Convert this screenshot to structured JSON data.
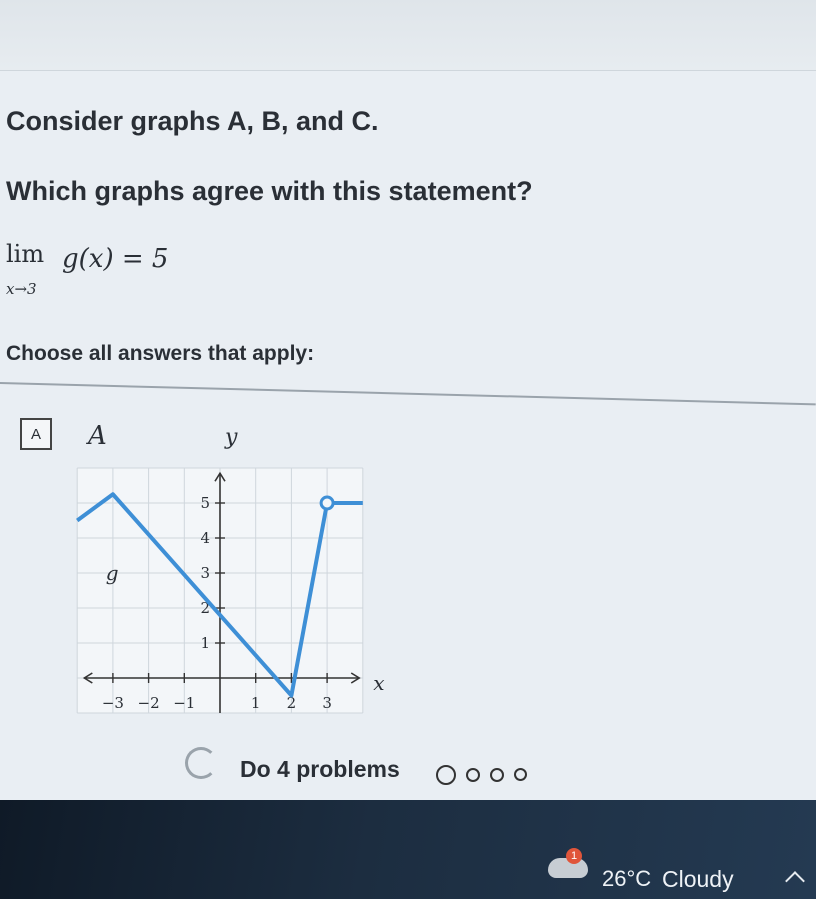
{
  "question": {
    "intro": "Consider graphs A, B, and C.",
    "prompt": "Which graphs agree with this statement?",
    "limit": {
      "word": "lim",
      "approach": "x→3",
      "expression": "g(x) = 5"
    },
    "instruction": "Choose all answers that apply:"
  },
  "choice_a": {
    "box_label": "A",
    "graph_label": "A",
    "x_axis_label": "x",
    "y_axis_label": "y",
    "function_label": "g",
    "x_tick_labels": [
      "−3",
      "−2",
      "−1",
      "1",
      "2",
      "3"
    ],
    "y_tick_labels": [
      "1",
      "2",
      "3",
      "4",
      "5"
    ]
  },
  "chart_data": {
    "type": "line",
    "title": "A",
    "xlabel": "x",
    "ylabel": "y",
    "xlim": [
      -4,
      4
    ],
    "ylim": [
      -1,
      6
    ],
    "grid": true,
    "series": [
      {
        "name": "g",
        "points": [
          [
            -4,
            4.5
          ],
          [
            -3,
            5.25
          ],
          [
            2,
            -0.5
          ],
          [
            3,
            5
          ],
          [
            4,
            5
          ]
        ],
        "open_points": [
          [
            3,
            5
          ]
        ]
      }
    ]
  },
  "footer": {
    "status": "Do 4 problems",
    "progress_total": 4,
    "progress_current": 1
  },
  "taskbar": {
    "badge": "1",
    "temperature": "26°C",
    "condition": "Cloudy"
  },
  "colors": {
    "curve": "#3e8fd6",
    "background": "#e9eef3",
    "taskbar": "#162435"
  }
}
